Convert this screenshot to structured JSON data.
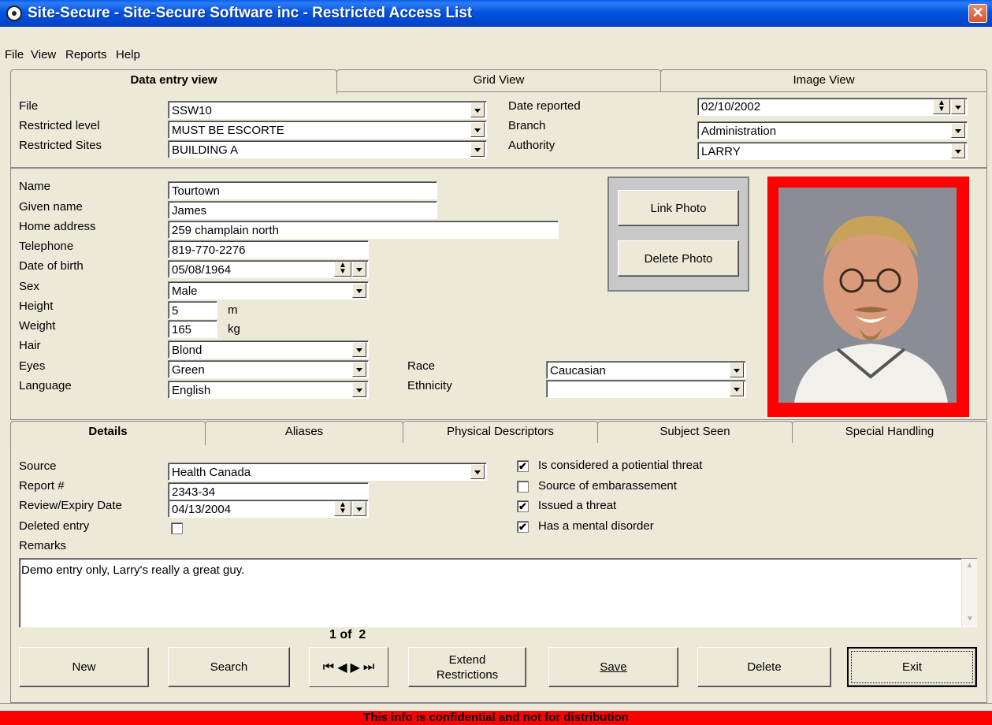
{
  "window": {
    "title": "Site-Secure - Site-Secure Software inc - Restricted Access List",
    "close": "✕"
  },
  "menu": [
    "File",
    "View",
    "Reports",
    "Help"
  ],
  "top_tabs": [
    "Data entry view",
    "Grid View",
    "Image View"
  ],
  "file_section": {
    "file_label": "File",
    "file_value": "SSW10",
    "restricted_level_label": "Restricted level",
    "restricted_level_value": "MUST BE ESCORTE",
    "restricted_sites_label": "Restricted Sites",
    "restricted_sites_value": "BUILDING A",
    "date_reported_label": "Date reported",
    "date_reported_value": "02/10/2002",
    "branch_label": "Branch",
    "branch_value": "Administration",
    "authority_label": "Authority",
    "authority_value": "LARRY"
  },
  "person": {
    "name_label": "Name",
    "name_value": "Tourtown",
    "given_name_label": "Given name",
    "given_name_value": "James",
    "home_address_label": "Home address",
    "home_address_value": "259 champlain north",
    "telephone_label": "Telephone",
    "telephone_value": "819-770-2276",
    "dob_label": "Date of birth",
    "dob_value": "05/08/1964",
    "sex_label": "Sex",
    "sex_value": "Male",
    "height_label": "Height",
    "height_value": "5",
    "height_unit": "m",
    "weight_label": "Weight",
    "weight_value": "165",
    "weight_unit": "kg",
    "hair_label": "Hair",
    "hair_value": "Blond",
    "eyes_label": "Eyes",
    "eyes_value": "Green",
    "language_label": "Language",
    "language_value": "English",
    "race_label": "Race",
    "race_value": "Caucasian",
    "ethnicity_label": "Ethnicity",
    "ethnicity_value": ""
  },
  "photo": {
    "link_label": "Link Photo",
    "delete_label": "Delete Photo",
    "border_color": "#ff0000"
  },
  "detail_tabs": [
    "Details",
    "Aliases",
    "Physical Descriptors",
    "Subject Seen",
    "Special Handling"
  ],
  "details": {
    "source_label": "Source",
    "source_value": "Health Canada",
    "report_label": "Report #",
    "report_value": "2343-34",
    "review_label": "Review/Expiry Date",
    "review_value": "04/13/2004",
    "deleted_label": "Deleted entry",
    "remarks_label": "Remarks",
    "remarks_value": "Demo entry only, Larry's really a great guy.",
    "checks": [
      {
        "label": "Is considered a potiential threat",
        "checked": true
      },
      {
        "label": "Source of embarassement",
        "checked": false
      },
      {
        "label": "Issued a threat",
        "checked": true
      },
      {
        "label": "Has a mental disorder",
        "checked": true
      }
    ]
  },
  "navigation": {
    "record_counter": "1 of  2"
  },
  "buttons": {
    "new": "New",
    "search": "Search",
    "extend_1": "Extend",
    "extend_2": "Restrictions",
    "save": "Save",
    "delete": "Delete",
    "exit": "Exit"
  },
  "footer": "This info is confidential and not for distribution"
}
